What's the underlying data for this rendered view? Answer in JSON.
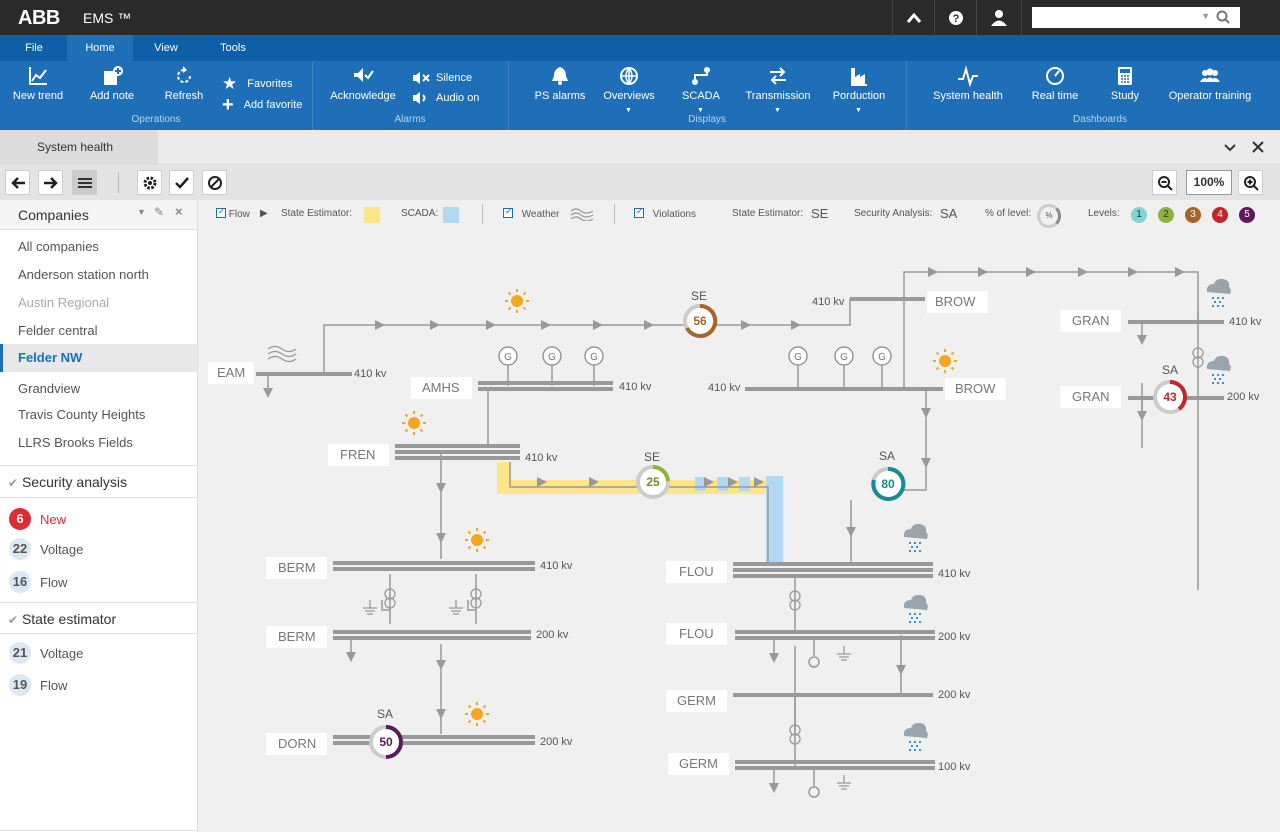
{
  "app": {
    "logo": "ABB",
    "name": "EMS ™"
  },
  "menu": [
    "File",
    "Home",
    "View",
    "Tools"
  ],
  "ribbon": {
    "operations": {
      "title": "Operations",
      "new_trend": "New trend",
      "add_note": "Add note",
      "refresh": "Refresh",
      "favorites": "Favorites",
      "add_favorite": "Add favorite"
    },
    "alarms": {
      "title": "Alarms",
      "acknowledge": "Acknowledge",
      "silence": "Silence",
      "audio_on": "Audio on"
    },
    "displays": {
      "title": "Displays",
      "ps_alarms": "PS alarms",
      "overviews": "Overviews",
      "scada": "SCADA",
      "transmission": "Transmission",
      "production": "Porduction"
    },
    "dashboards": {
      "title": "Dashboards",
      "system_health": "System health",
      "real_time": "Real time",
      "study": "Study",
      "operator_training": "Operator training"
    }
  },
  "tab": "System health",
  "zoom": "100%",
  "sidebar": {
    "companies_title": "Companies",
    "companies": [
      "All companies",
      "Anderson station north",
      "Austin Regional",
      "Felder central",
      "Felder NW",
      "Grandview",
      "Travis County Heights",
      "LLRS Brooks Fields"
    ],
    "security": {
      "title": "Security analysis",
      "items": [
        {
          "count": "6",
          "label": "New"
        },
        {
          "count": "22",
          "label": "Voltage"
        },
        {
          "count": "16",
          "label": "Flow"
        }
      ]
    },
    "estimator": {
      "title": "State estimator",
      "items": [
        {
          "count": "21",
          "label": "Voltage"
        },
        {
          "count": "19",
          "label": "Flow"
        }
      ]
    }
  },
  "legend": {
    "flow": "Flow",
    "state_estimator": "State Estimator:",
    "scada": "SCADA:",
    "weather": "Weather",
    "violations": "Violations",
    "se_label": "State Estimator:",
    "se": "SE",
    "sa_label": "Security Analysis:",
    "sa": "SA",
    "pct_label": "% of level:",
    "pct": "%",
    "levels_label": "Levels:",
    "levels": [
      "1",
      "2",
      "3",
      "4",
      "5"
    ]
  },
  "diagram": {
    "stations": [
      "EAM",
      "AMHS",
      "FREN",
      "BERM",
      "BERM",
      "DORN",
      "BROW",
      "BROW",
      "GRAN",
      "GRAN",
      "FLOU",
      "FLOU",
      "GERM",
      "GERM"
    ],
    "voltages": [
      "410 kv",
      "410 kv",
      "410 kv",
      "410 kv",
      "200 kv",
      "200 kv",
      "410 kv",
      "410 kv",
      "410 kv",
      "200 kv",
      "410 kv",
      "200 kv",
      "200 kv",
      "100 kv"
    ],
    "gauges": [
      {
        "tag": "SE",
        "value": "56"
      },
      {
        "tag": "SE",
        "value": "25"
      },
      {
        "tag": "SA",
        "value": "80"
      },
      {
        "tag": "SA",
        "value": "43"
      },
      {
        "tag": "SA",
        "value": "50"
      }
    ],
    "generator": "G"
  },
  "colors": {
    "brand_blue": "#1e6fb8",
    "menu_blue": "#0d5fa8",
    "level1": "#7fd4d4",
    "level2": "#8bb43a",
    "level3": "#a5652b",
    "level4": "#c0272d",
    "level5": "#5b1a5b",
    "sun": "#f5a623",
    "se_fill": "#fde68a",
    "scada_fill": "#b3d9f2"
  }
}
